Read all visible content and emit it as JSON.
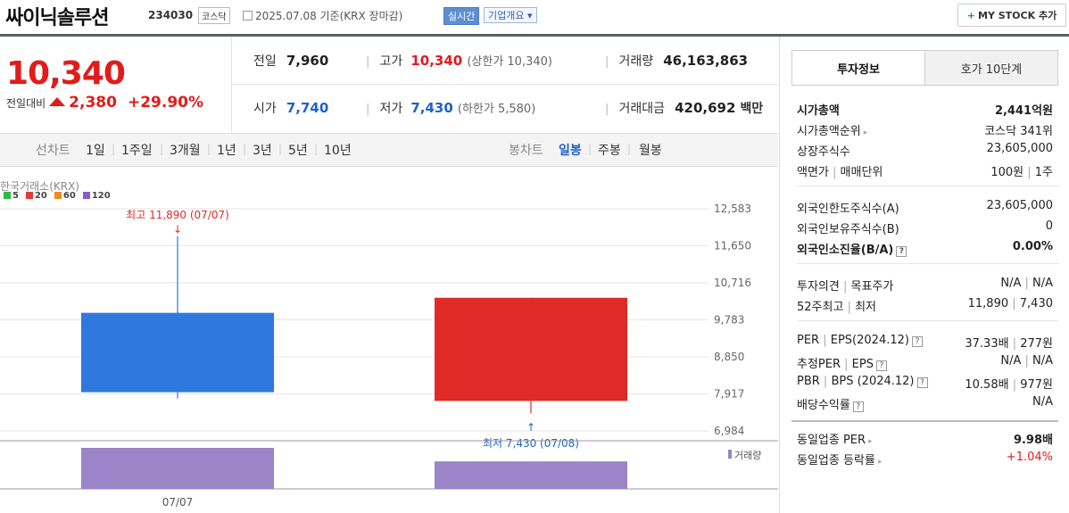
{
  "header": {
    "name": "싸이닉솔루션",
    "code": "234030",
    "market_badge": "코스닥",
    "date_text": "2025.07.08  기준(KRX 장마감)",
    "live_badge": "실시간",
    "corp_badge": "기업개요 ▾",
    "mystock": "MY STOCK 추가",
    "mystock_plus": "+"
  },
  "price": {
    "current": "10,340",
    "diff_label": "전일대비",
    "diff": "2,380",
    "rate": "+29.90%"
  },
  "stats": {
    "prev_label": "전일",
    "prev": "7,960",
    "open_label": "시가",
    "open": "7,740",
    "high_label": "고가",
    "high": "10,340",
    "upper_limit": "(상한가 10,340)",
    "low_label": "저가",
    "low": "7,430",
    "lower_limit": "(하한가 5,580)",
    "vol_label": "거래량",
    "vol": "46,163,863",
    "amt_label": "거래대금",
    "amt": "420,692",
    "amt_unit": "백만"
  },
  "toolbar": {
    "line_label": "선차트",
    "line_items": [
      "1일",
      "1주일",
      "3개월",
      "1년",
      "3년",
      "5년",
      "10년"
    ],
    "candle_label": "봉차트",
    "candle_items": [
      "일봉",
      "주봉",
      "월봉"
    ]
  },
  "chart_data": {
    "type": "candlestick",
    "source": "한국거래소(KRX)",
    "ma_legend": [
      {
        "label": "5",
        "color": "#2fb84a"
      },
      {
        "label": "20",
        "color": "#e03b3b"
      },
      {
        "label": "60",
        "color": "#f08a24"
      },
      {
        "label": "120",
        "color": "#8a5cc7"
      }
    ],
    "y_ticks": [
      "12,583",
      "11,650",
      "10,716",
      "9,783",
      "8,850",
      "7,917",
      "6,984"
    ],
    "y_tick_values": [
      12583,
      11650,
      10716,
      9783,
      8850,
      7917,
      6984
    ],
    "candles": [
      {
        "date": "07/07",
        "open": 9960,
        "high": 11890,
        "low": 7800,
        "close": 7960,
        "color": "#2e78de"
      },
      {
        "date": "07/08",
        "open": 7740,
        "high": 10340,
        "low": 7430,
        "close": 10340,
        "color": "#e02a26"
      }
    ],
    "high_annotation": "최고 11,890 (07/07)",
    "low_annotation": "최저 7,430 (07/08)",
    "volume_label": "거래량",
    "volume_color": "#9b84c8",
    "volume": [
      1,
      0.67
    ],
    "x_labels": [
      "07/07"
    ]
  },
  "panel": {
    "tab_info": "투자정보",
    "tab_hoga": "호가 10단계",
    "rows1": [
      {
        "k": "시가총액",
        "v": "2,441억원",
        "bold": true
      },
      {
        "k": "시가총액순위",
        "v": "코스닥 341위",
        "arrow": true
      },
      {
        "k": "상장주식수",
        "v": "23,605,000"
      },
      {
        "k": "액면가",
        "k2": "매매단위",
        "v": "100원",
        "v2": "1주"
      }
    ],
    "rows2": [
      {
        "k": "외국인한도주식수(A)",
        "v": "23,605,000"
      },
      {
        "k": "외국인보유주식수(B)",
        "v": "0"
      },
      {
        "k": "외국인소진율(B/A)",
        "v": "0.00%",
        "bold": true,
        "q": true
      }
    ],
    "rows3": [
      {
        "k": "투자의견",
        "k2": "목표주가",
        "v": "N/A",
        "v2": "N/A"
      },
      {
        "k": "52주최고",
        "k2": "최저",
        "v": "11,890",
        "v2": "7,430"
      }
    ],
    "rows4": [
      {
        "k": "PER",
        "k2": "EPS(2024.12)",
        "v": "37.33배",
        "v2": "277원",
        "q": true
      },
      {
        "k": "추정PER",
        "k2": "EPS",
        "v": "N/A",
        "v2": "N/A",
        "q": true
      },
      {
        "k": "PBR",
        "k2": "BPS (2024.12)",
        "v": "10.58배",
        "v2": "977원",
        "q": true
      },
      {
        "k": "배당수익률",
        "v": "N/A",
        "q": true
      }
    ],
    "rows5": [
      {
        "k": "동일업종 PER",
        "v": "9.98배",
        "bold_v": true,
        "arrow": true
      },
      {
        "k": "동일업종 등락률",
        "v": "+1.04%",
        "red_v": true,
        "arrow": true
      }
    ]
  }
}
